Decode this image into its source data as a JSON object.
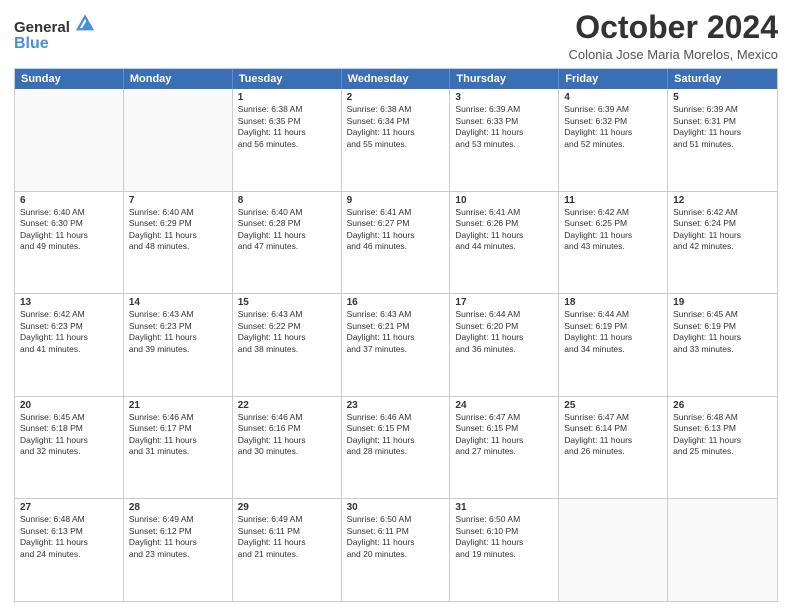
{
  "logo": {
    "line1": "General",
    "line2": "Blue"
  },
  "title": "October 2024",
  "subtitle": "Colonia Jose Maria Morelos, Mexico",
  "header": {
    "days": [
      "Sunday",
      "Monday",
      "Tuesday",
      "Wednesday",
      "Thursday",
      "Friday",
      "Saturday"
    ]
  },
  "rows": [
    [
      {
        "day": "",
        "text": "",
        "empty": true
      },
      {
        "day": "",
        "text": "",
        "empty": true
      },
      {
        "day": "1",
        "text": "Sunrise: 6:38 AM\nSunset: 6:35 PM\nDaylight: 11 hours\nand 56 minutes."
      },
      {
        "day": "2",
        "text": "Sunrise: 6:38 AM\nSunset: 6:34 PM\nDaylight: 11 hours\nand 55 minutes."
      },
      {
        "day": "3",
        "text": "Sunrise: 6:39 AM\nSunset: 6:33 PM\nDaylight: 11 hours\nand 53 minutes."
      },
      {
        "day": "4",
        "text": "Sunrise: 6:39 AM\nSunset: 6:32 PM\nDaylight: 11 hours\nand 52 minutes."
      },
      {
        "day": "5",
        "text": "Sunrise: 6:39 AM\nSunset: 6:31 PM\nDaylight: 11 hours\nand 51 minutes."
      }
    ],
    [
      {
        "day": "6",
        "text": "Sunrise: 6:40 AM\nSunset: 6:30 PM\nDaylight: 11 hours\nand 49 minutes."
      },
      {
        "day": "7",
        "text": "Sunrise: 6:40 AM\nSunset: 6:29 PM\nDaylight: 11 hours\nand 48 minutes."
      },
      {
        "day": "8",
        "text": "Sunrise: 6:40 AM\nSunset: 6:28 PM\nDaylight: 11 hours\nand 47 minutes."
      },
      {
        "day": "9",
        "text": "Sunrise: 6:41 AM\nSunset: 6:27 PM\nDaylight: 11 hours\nand 46 minutes."
      },
      {
        "day": "10",
        "text": "Sunrise: 6:41 AM\nSunset: 6:26 PM\nDaylight: 11 hours\nand 44 minutes."
      },
      {
        "day": "11",
        "text": "Sunrise: 6:42 AM\nSunset: 6:25 PM\nDaylight: 11 hours\nand 43 minutes."
      },
      {
        "day": "12",
        "text": "Sunrise: 6:42 AM\nSunset: 6:24 PM\nDaylight: 11 hours\nand 42 minutes."
      }
    ],
    [
      {
        "day": "13",
        "text": "Sunrise: 6:42 AM\nSunset: 6:23 PM\nDaylight: 11 hours\nand 41 minutes."
      },
      {
        "day": "14",
        "text": "Sunrise: 6:43 AM\nSunset: 6:23 PM\nDaylight: 11 hours\nand 39 minutes."
      },
      {
        "day": "15",
        "text": "Sunrise: 6:43 AM\nSunset: 6:22 PM\nDaylight: 11 hours\nand 38 minutes."
      },
      {
        "day": "16",
        "text": "Sunrise: 6:43 AM\nSunset: 6:21 PM\nDaylight: 11 hours\nand 37 minutes."
      },
      {
        "day": "17",
        "text": "Sunrise: 6:44 AM\nSunset: 6:20 PM\nDaylight: 11 hours\nand 36 minutes."
      },
      {
        "day": "18",
        "text": "Sunrise: 6:44 AM\nSunset: 6:19 PM\nDaylight: 11 hours\nand 34 minutes."
      },
      {
        "day": "19",
        "text": "Sunrise: 6:45 AM\nSunset: 6:19 PM\nDaylight: 11 hours\nand 33 minutes."
      }
    ],
    [
      {
        "day": "20",
        "text": "Sunrise: 6:45 AM\nSunset: 6:18 PM\nDaylight: 11 hours\nand 32 minutes."
      },
      {
        "day": "21",
        "text": "Sunrise: 6:46 AM\nSunset: 6:17 PM\nDaylight: 11 hours\nand 31 minutes."
      },
      {
        "day": "22",
        "text": "Sunrise: 6:46 AM\nSunset: 6:16 PM\nDaylight: 11 hours\nand 30 minutes."
      },
      {
        "day": "23",
        "text": "Sunrise: 6:46 AM\nSunset: 6:15 PM\nDaylight: 11 hours\nand 28 minutes."
      },
      {
        "day": "24",
        "text": "Sunrise: 6:47 AM\nSunset: 6:15 PM\nDaylight: 11 hours\nand 27 minutes."
      },
      {
        "day": "25",
        "text": "Sunrise: 6:47 AM\nSunset: 6:14 PM\nDaylight: 11 hours\nand 26 minutes."
      },
      {
        "day": "26",
        "text": "Sunrise: 6:48 AM\nSunset: 6:13 PM\nDaylight: 11 hours\nand 25 minutes."
      }
    ],
    [
      {
        "day": "27",
        "text": "Sunrise: 6:48 AM\nSunset: 6:13 PM\nDaylight: 11 hours\nand 24 minutes."
      },
      {
        "day": "28",
        "text": "Sunrise: 6:49 AM\nSunset: 6:12 PM\nDaylight: 11 hours\nand 23 minutes."
      },
      {
        "day": "29",
        "text": "Sunrise: 6:49 AM\nSunset: 6:11 PM\nDaylight: 11 hours\nand 21 minutes."
      },
      {
        "day": "30",
        "text": "Sunrise: 6:50 AM\nSunset: 6:11 PM\nDaylight: 11 hours\nand 20 minutes."
      },
      {
        "day": "31",
        "text": "Sunrise: 6:50 AM\nSunset: 6:10 PM\nDaylight: 11 hours\nand 19 minutes."
      },
      {
        "day": "",
        "text": "",
        "empty": true
      },
      {
        "day": "",
        "text": "",
        "empty": true
      }
    ]
  ]
}
